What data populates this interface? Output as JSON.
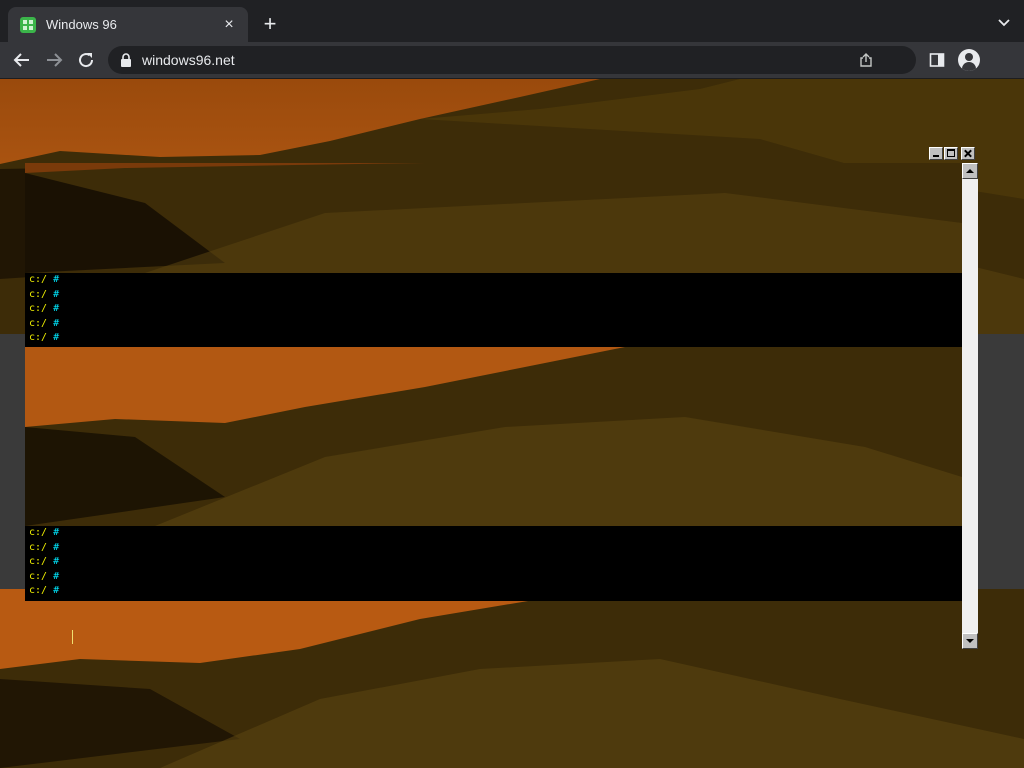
{
  "browser": {
    "tab_title": "Windows 96",
    "tab_close_glyph": "×",
    "new_tab_glyph": "+",
    "url": "windows96.net",
    "icons": [
      "back-icon",
      "forward-icon",
      "reload-icon",
      "lock-icon",
      "share-icon",
      "side-panel-icon",
      "profile-icon",
      "tab-list-icon"
    ]
  },
  "terminal": {
    "prompt_path": "c:/",
    "prompt_hash": "#",
    "block1_lines": 5,
    "block2_lines": 5
  },
  "colors": {
    "prompt_path": "#f0f000",
    "prompt_hash": "#00e8ff",
    "terminal_bg": "#000000"
  }
}
